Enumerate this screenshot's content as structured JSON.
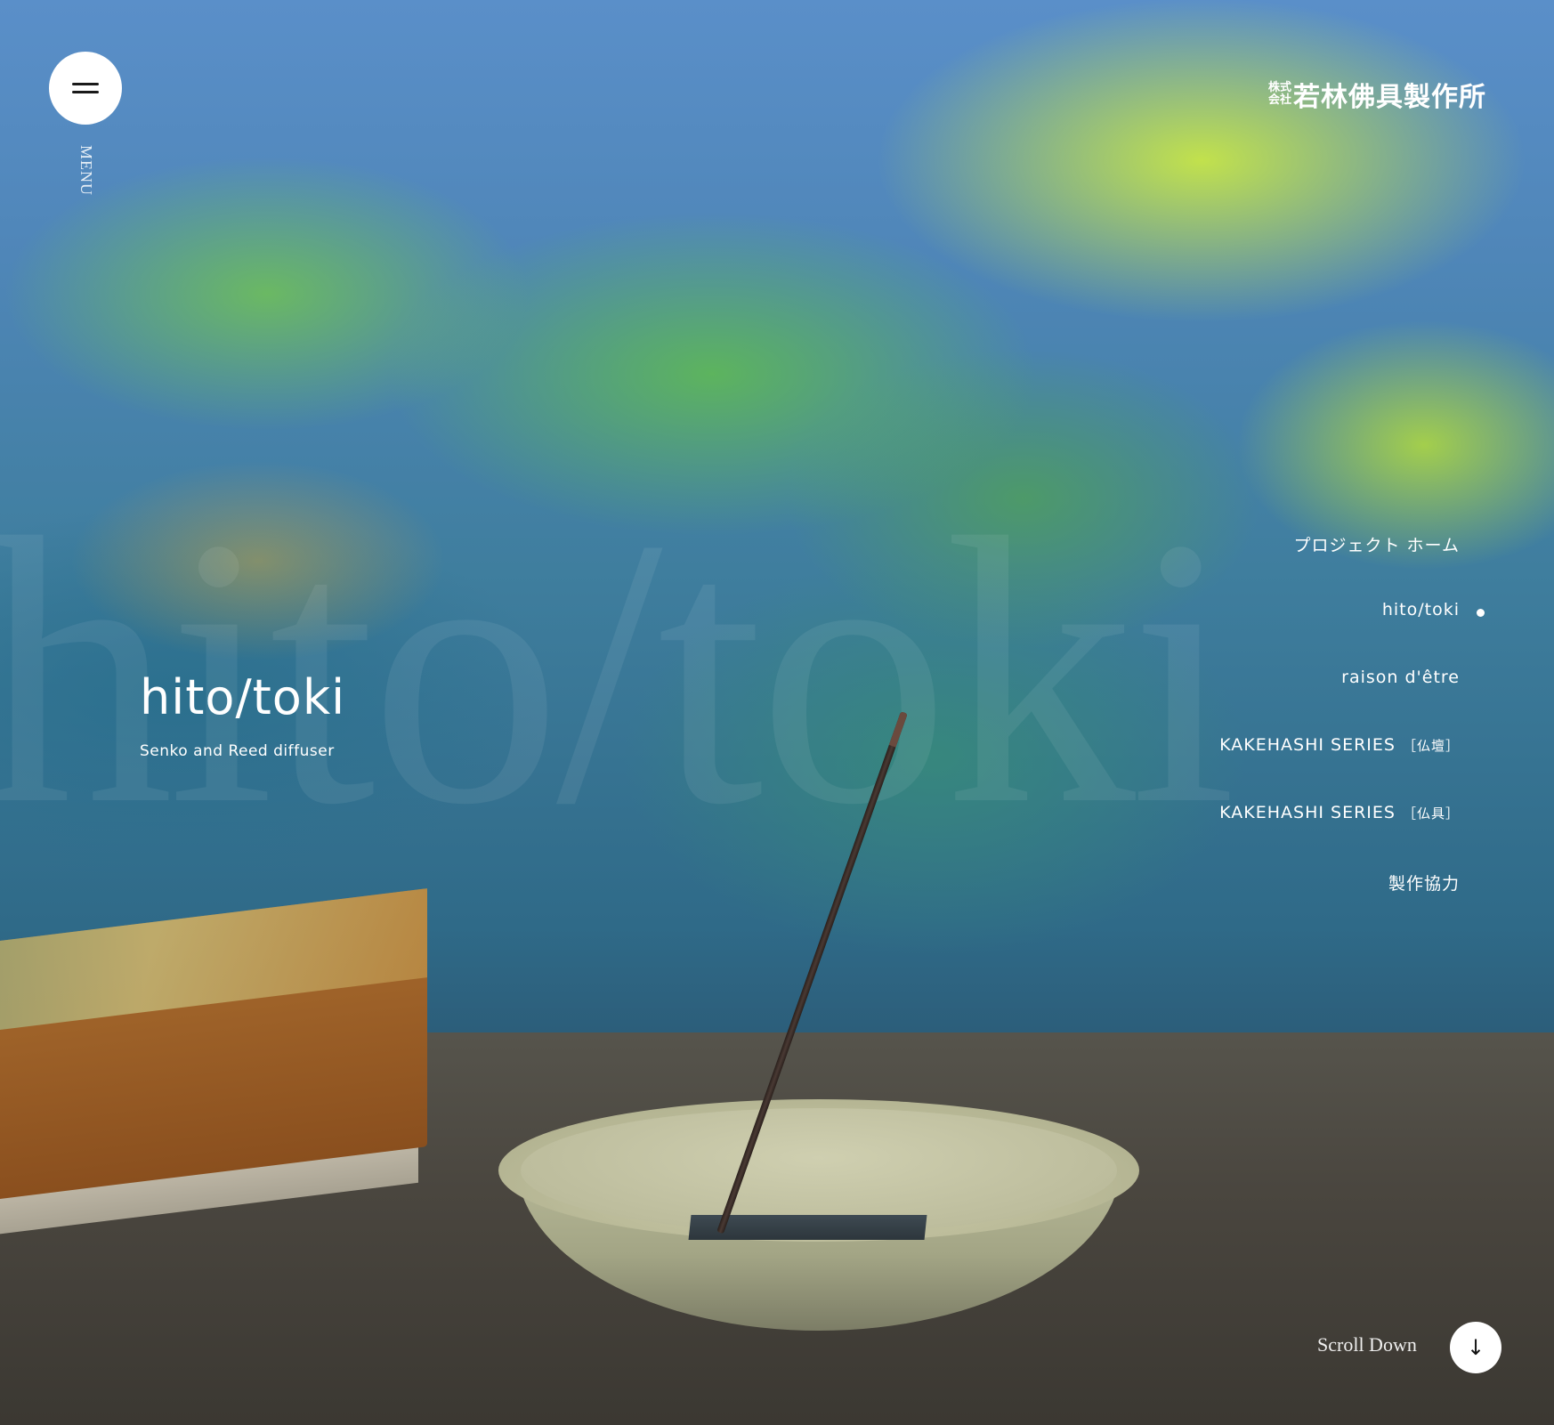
{
  "header": {
    "menu_label": "MENU",
    "logo": {
      "kabushiki_top": "株式",
      "kabushiki_bottom": "会社",
      "name": "若林佛具製作所"
    }
  },
  "hero": {
    "watermark": "hito/toki",
    "title": "hito/toki",
    "subtitle": "Senko and Reed diffuser"
  },
  "side_nav": {
    "items": [
      {
        "label": "プロジェクト ホーム",
        "suffix": "",
        "active": false
      },
      {
        "label": "hito/toki",
        "suffix": "",
        "active": true
      },
      {
        "label": "raison d'être",
        "suffix": "",
        "active": false
      },
      {
        "label": "KAKEHASHI SERIES",
        "suffix": "［仏壇］",
        "active": false
      },
      {
        "label": "KAKEHASHI SERIES",
        "suffix": "［仏具］",
        "active": false
      },
      {
        "label": "製作協力",
        "suffix": "",
        "active": false
      }
    ]
  },
  "scroll": {
    "label": "Scroll Down",
    "icon": "arrow-down-icon"
  },
  "icons": {
    "menu": "hamburger-menu-icon",
    "scroll": "arrow-down-icon"
  }
}
